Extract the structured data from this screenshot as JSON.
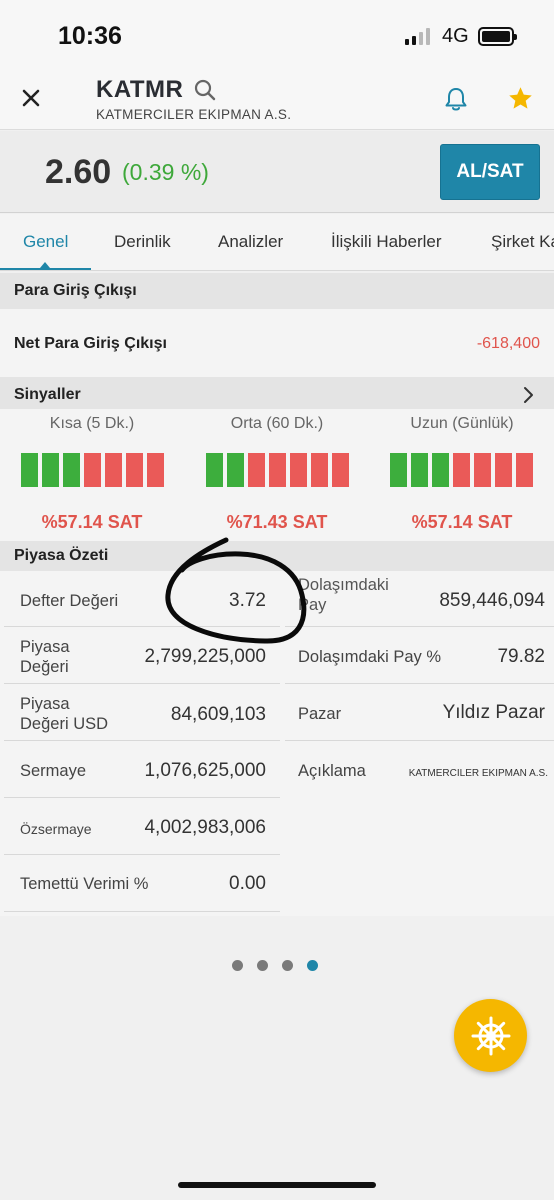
{
  "status_bar": {
    "time": "10:36",
    "network": "4G"
  },
  "header": {
    "ticker": "KATMR",
    "company": "KATMERCILER EKIPMAN A.S."
  },
  "price_bar": {
    "price": "2.60",
    "change": "(0.39 %)",
    "trade_label": "AL/SAT"
  },
  "tabs": [
    {
      "label": "Genel",
      "active": true
    },
    {
      "label": "Derinlik"
    },
    {
      "label": "Analizler"
    },
    {
      "label": "İlişkili Haberler"
    },
    {
      "label": "Şirket Ka"
    }
  ],
  "money_flow": {
    "section_title": "Para Giriş Çıkışı",
    "label": "Net Para Giriş Çıkışı",
    "value": "-618,400"
  },
  "signals": {
    "section_title": "Sinyaller",
    "items": [
      {
        "title": "Kısa (5 Dk.)",
        "value": "%57.14 SAT",
        "buy_count": 3,
        "sell_count": 4
      },
      {
        "title": "Orta (60 Dk.)",
        "value": "%71.43 SAT",
        "buy_count": 2,
        "sell_count": 5
      },
      {
        "title": "Uzun (Günlük)",
        "value": "%57.14 SAT",
        "buy_count": 3,
        "sell_count": 4
      }
    ]
  },
  "market_summary": {
    "section_title": "Piyasa Özeti",
    "left": [
      {
        "label": "Defter Değeri",
        "value": "3.72"
      },
      {
        "label": "Piyasa\nDeğeri",
        "value": "2,799,225,000"
      },
      {
        "label": "Piyasa\nDeğeri USD",
        "value": "84,609,103"
      },
      {
        "label": "Sermaye",
        "value": "1,076,625,000"
      },
      {
        "label": "Özsermaye",
        "value": "4,002,983,006"
      },
      {
        "label": "Temettü Verimi %",
        "value": "0.00"
      }
    ],
    "right": [
      {
        "label": "Dolaşımdaki\nPay",
        "value": "859,446,094"
      },
      {
        "label": "Dolaşımdaki Pay %",
        "value": "79.82"
      },
      {
        "label": "Pazar",
        "value": "Yıldız Pazar"
      },
      {
        "label": "Açıklama",
        "value": "KATMERCILER EKIPMAN A.S."
      }
    ]
  },
  "pager": {
    "count": 4,
    "active_index": 3
  },
  "colors": {
    "accent": "#1f86a8",
    "positive": "#3ea83a",
    "negative": "#e0544c",
    "signal_buy": "#3dae3d",
    "signal_sell": "#ea5a58",
    "fab": "#f5b700",
    "star": "#f5b700"
  },
  "icons": {
    "close": "close-icon",
    "search": "search-icon",
    "bell": "bell-icon",
    "star": "star-icon",
    "chevron": "chevron-right-icon",
    "fab": "ship-wheel-icon"
  }
}
